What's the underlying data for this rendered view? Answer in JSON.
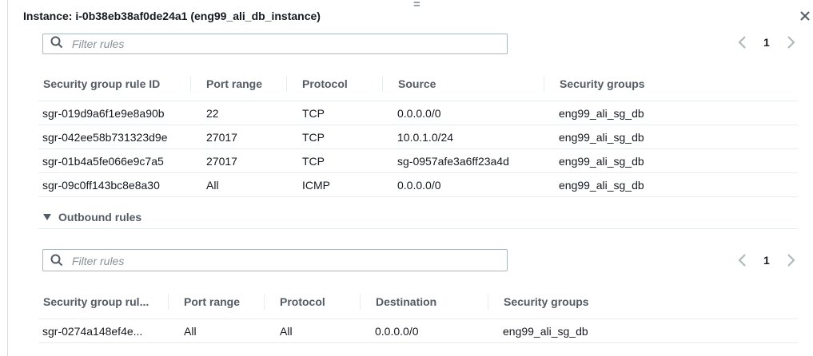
{
  "header": {
    "title": "Instance: i-0b38eb38af0de24a1 (eng99_ali_db_instance)",
    "drag_handle": "="
  },
  "inbound": {
    "filter_placeholder": "Filter rules",
    "page": "1",
    "columns": [
      "Security group rule ID",
      "Port range",
      "Protocol",
      "Source",
      "Security groups"
    ],
    "rows": [
      [
        "sgr-019d9a6f1e9e8a90b",
        "22",
        "TCP",
        "0.0.0.0/0",
        "eng99_ali_sg_db"
      ],
      [
        "sgr-042ee58b731323d9e",
        "27017",
        "TCP",
        "10.0.1.0/24",
        "eng99_ali_sg_db"
      ],
      [
        "sgr-01b4a5fe066e9c7a5",
        "27017",
        "TCP",
        "sg-0957afe3a6ff23a4d",
        "eng99_ali_sg_db"
      ],
      [
        "sgr-09c0ff143bc8e8a30",
        "All",
        "ICMP",
        "0.0.0.0/0",
        "eng99_ali_sg_db"
      ]
    ]
  },
  "outbound": {
    "section_title": "Outbound rules",
    "filter_placeholder": "Filter rules",
    "page": "1",
    "columns": [
      "Security group rul...",
      "Port range",
      "Protocol",
      "Destination",
      "Security groups"
    ],
    "rows": [
      [
        "sgr-0274a148ef4e...",
        "All",
        "All",
        "0.0.0.0/0",
        "eng99_ali_sg_db"
      ]
    ]
  },
  "icons": {
    "search": "search-icon",
    "close": "close-icon",
    "prev": "chevron-left-icon",
    "next": "chevron-right-icon",
    "caret": "caret-down-icon"
  },
  "colors": {
    "text": "#16191f",
    "muted": "#545b64",
    "border": "#eaeded",
    "input_border": "#aab7b8"
  }
}
